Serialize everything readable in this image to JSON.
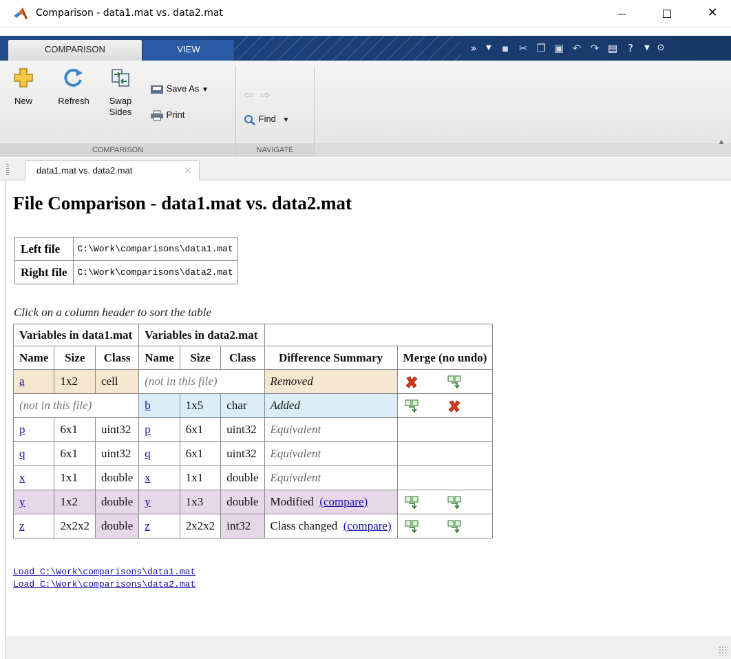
{
  "window": {
    "title": "Comparison - data1.mat vs. data2.mat",
    "minimize_label": "–",
    "maximize_label": "□",
    "close_label": "✕"
  },
  "ribbon_tabs": [
    {
      "label": "COMPARISON"
    },
    {
      "label": "VIEW"
    }
  ],
  "quick_access": [
    "pin-icon",
    "dropdown-icon",
    "save-icon",
    "cut-icon",
    "copy-icon",
    "paste-icon",
    "undo-icon",
    "redo-icon",
    "switch-windows-icon",
    "help-icon",
    "dropdown-icon",
    "expand-icon"
  ],
  "ribbon": {
    "new_label": "New",
    "refresh_label": "Refresh",
    "swap_label": "Swap Sides",
    "save_as_label": "Save As",
    "print_label": "Print",
    "find_label": "Find",
    "group_comparison": "COMPARISON",
    "group_navigate": "NAVIGATE"
  },
  "doc_tab": {
    "label": "data1.mat vs. data2.mat"
  },
  "page": {
    "title": "File Comparison - data1.mat vs. data2.mat",
    "files": [
      {
        "label": "Left file",
        "path": "C:\\Work\\comparisons\\data1.mat"
      },
      {
        "label": "Right file",
        "path": "C:\\Work\\comparisons\\data2.mat"
      }
    ],
    "sort_hint": "Click on a column header to sort the table",
    "table": {
      "group_left": "Variables in data1.mat",
      "group_right": "Variables in data2.mat",
      "columns": [
        "Name",
        "Size",
        "Class",
        "Name",
        "Size",
        "Class",
        "Difference Summary",
        "Merge (no undo)"
      ],
      "not_in_file": "(not in this file)",
      "rows": [
        {
          "l_name": "a",
          "l_size": "1x2",
          "l_class": "cell",
          "r_name": "",
          "r_size": "",
          "r_class": "",
          "summary": "Removed",
          "link": ""
        },
        {
          "l_name": "",
          "l_size": "",
          "l_class": "",
          "r_name": "b",
          "r_size": "1x5",
          "r_class": "char",
          "summary": "Added",
          "link": ""
        },
        {
          "l_name": "p",
          "l_size": "6x1",
          "l_class": "uint32",
          "r_name": "p",
          "r_size": "6x1",
          "r_class": "uint32",
          "summary": "Equivalent",
          "link": ""
        },
        {
          "l_name": "q",
          "l_size": "6x1",
          "l_class": "uint32",
          "r_name": "q",
          "r_size": "6x1",
          "r_class": "uint32",
          "summary": "Equivalent",
          "link": ""
        },
        {
          "l_name": "x",
          "l_size": "1x1",
          "l_class": "double",
          "r_name": "x",
          "r_size": "1x1",
          "r_class": "double",
          "summary": "Equivalent",
          "link": ""
        },
        {
          "l_name": "y",
          "l_size": "1x2",
          "l_class": "double",
          "r_name": "y",
          "r_size": "1x3",
          "r_class": "double",
          "summary": "Modified",
          "link": "(compare)"
        },
        {
          "l_name": "z",
          "l_size": "2x2x2",
          "l_class": "double",
          "r_name": "z",
          "r_size": "2x2x2",
          "r_class": "int32",
          "summary": "Class changed",
          "link": "(compare)"
        }
      ]
    },
    "load_links": [
      "Load C:\\Work\\comparisons\\data1.mat",
      "Load C:\\Work\\comparisons\\data2.mat"
    ]
  },
  "colors": {
    "removed_bg": "#f5e7d0",
    "added_bg": "#dbeef7",
    "modified_bg": "#e6d7e9",
    "link": "#1a0dab",
    "tabstrip": "#1b3f7b"
  }
}
